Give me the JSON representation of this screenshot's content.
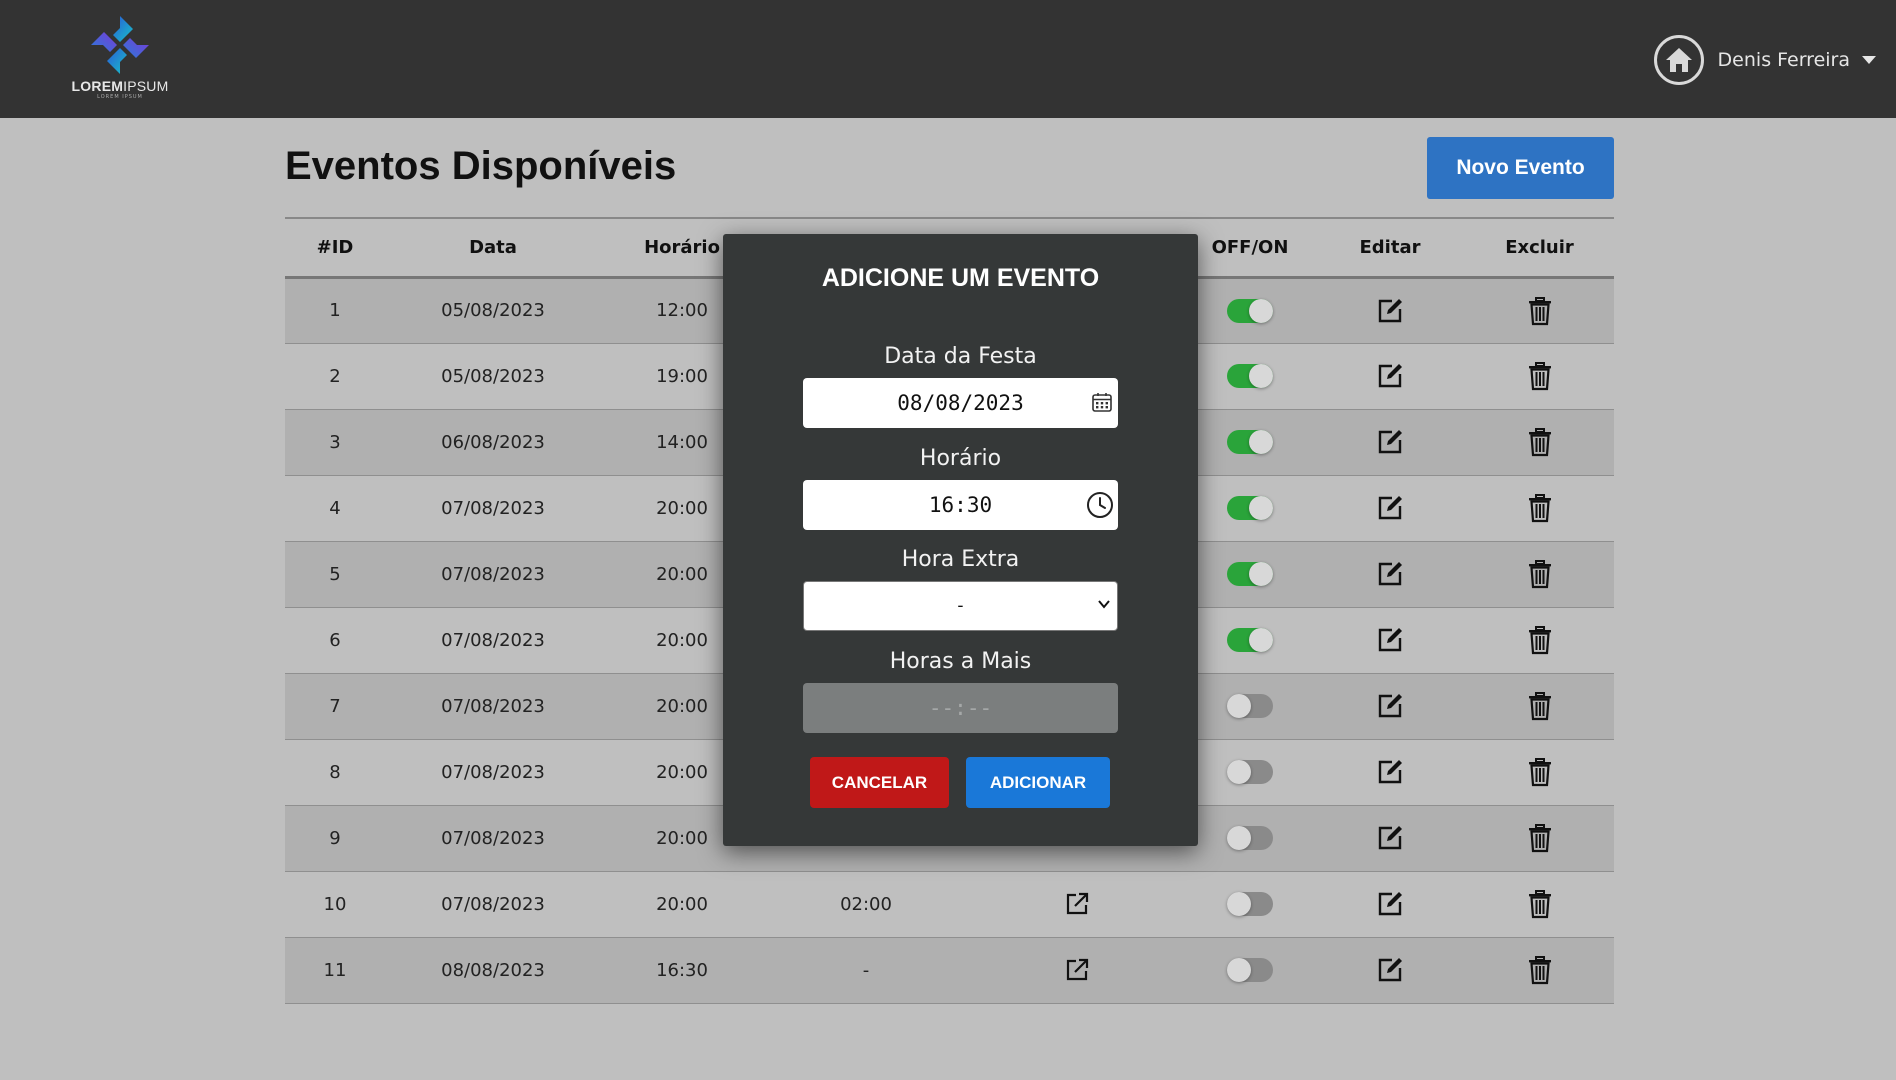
{
  "header": {
    "logo_text_bold": "LOREM",
    "logo_text_light": "IPSUM",
    "logo_subtext": "LOREM IPSUM",
    "user_name": "Denis Ferreira",
    "home_icon": "home-icon"
  },
  "page": {
    "title": "Eventos Disponíveis",
    "new_event_label": "Novo Evento"
  },
  "table": {
    "columns": [
      "#ID",
      "Data",
      "Horário",
      "",
      "",
      "OFF/ON",
      "Editar",
      "Excluir"
    ],
    "rows": [
      {
        "id": "1",
        "data": "05/08/2023",
        "horario": "12:00",
        "extra": "",
        "link": false,
        "on": true
      },
      {
        "id": "2",
        "data": "05/08/2023",
        "horario": "19:00",
        "extra": "",
        "link": false,
        "on": true
      },
      {
        "id": "3",
        "data": "06/08/2023",
        "horario": "14:00",
        "extra": "",
        "link": false,
        "on": true
      },
      {
        "id": "4",
        "data": "07/08/2023",
        "horario": "20:00",
        "extra": "",
        "link": false,
        "on": true
      },
      {
        "id": "5",
        "data": "07/08/2023",
        "horario": "20:00",
        "extra": "",
        "link": false,
        "on": true
      },
      {
        "id": "6",
        "data": "07/08/2023",
        "horario": "20:00",
        "extra": "",
        "link": false,
        "on": true
      },
      {
        "id": "7",
        "data": "07/08/2023",
        "horario": "20:00",
        "extra": "",
        "link": false,
        "on": false
      },
      {
        "id": "8",
        "data": "07/08/2023",
        "horario": "20:00",
        "extra": "",
        "link": false,
        "on": false
      },
      {
        "id": "9",
        "data": "07/08/2023",
        "horario": "20:00",
        "extra": "",
        "link": false,
        "on": false
      },
      {
        "id": "10",
        "data": "07/08/2023",
        "horario": "20:00",
        "extra": "02:00",
        "link": true,
        "on": false
      },
      {
        "id": "11",
        "data": "08/08/2023",
        "horario": "16:30",
        "extra": "-",
        "link": true,
        "on": false
      }
    ]
  },
  "modal": {
    "title": "ADICIONE UM EVENTO",
    "date_label": "Data da Festa",
    "date_value": "08/08/2023",
    "time_label": "Horário",
    "time_value": "16:30",
    "extra_label": "Hora Extra",
    "extra_value": "-",
    "more_label": "Horas a Mais",
    "more_placeholder": "--:--",
    "cancel_label": "CANCELAR",
    "add_label": "ADICIONAR"
  },
  "colors": {
    "topbar": "#333333",
    "background": "#bfbfbf",
    "primary": "#2e73c3",
    "toggle_on": "#2aa43a",
    "cancel": "#c01818",
    "add": "#1a78d8"
  }
}
